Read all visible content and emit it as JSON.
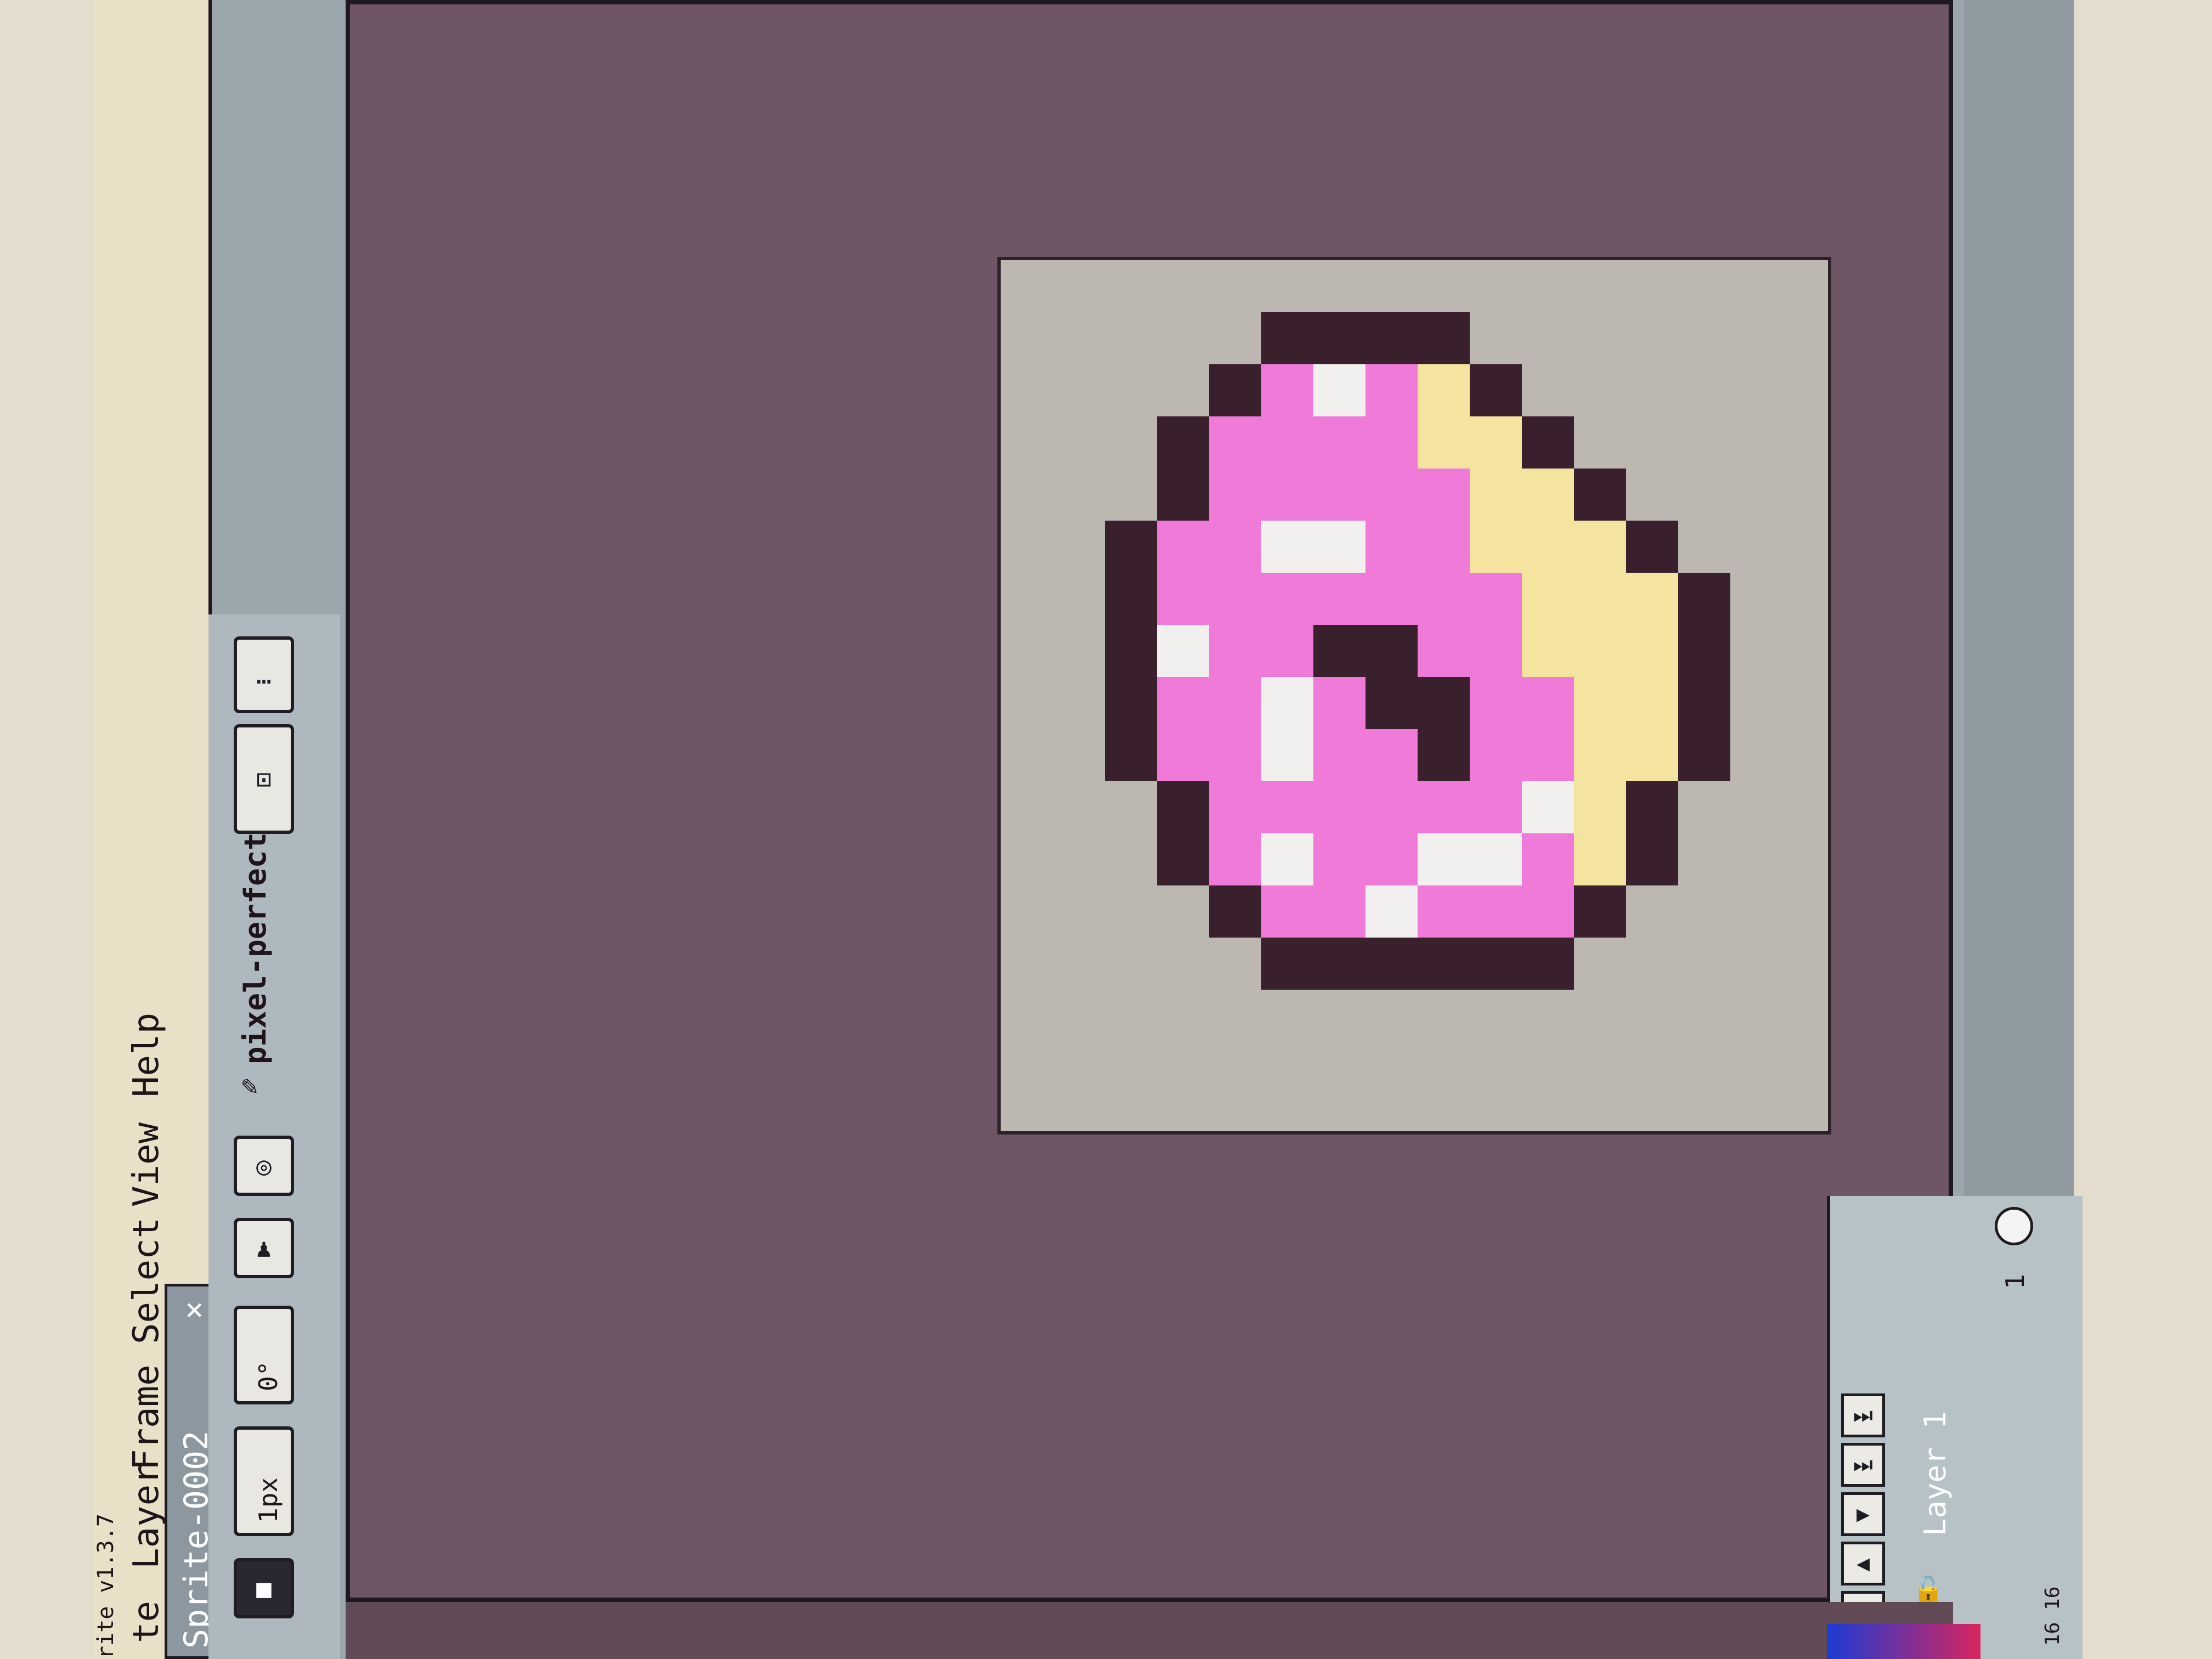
{
  "app": {
    "title": "rite v1.3.7"
  },
  "menu": {
    "items": [
      "te",
      "Layer",
      "Frame",
      "Select",
      "View",
      "Help"
    ]
  },
  "tab": {
    "name": "Sprite-0002",
    "close": "×"
  },
  "brush": {
    "size": "1px",
    "angle": "0°"
  },
  "options": {
    "pixel_perfect": "pixel-perfect",
    "more": "…"
  },
  "layers": [
    {
      "name": "Layer 1",
      "visible": true
    }
  ],
  "frames": {
    "header": "1",
    "size_readout": "16 16"
  },
  "colors": {
    "background": "#6f5667",
    "checker": "#bdb7b1",
    "outline": "#3a1f2d",
    "frosting": "#f07ad8",
    "dough": "#f5e3a0",
    "sprinkle": "#f2f0ef"
  },
  "icons": {
    "pencil": "pencil-icon",
    "record": "record-icon",
    "pixel_perfect": "brush-icon",
    "first_frame": "first-frame-icon",
    "prev_frame": "prev-frame-icon",
    "play": "play-icon",
    "next_frame": "next-frame-icon",
    "last_frame": "last-frame-icon",
    "eye": "eye-icon",
    "lock": "lock-icon"
  }
}
